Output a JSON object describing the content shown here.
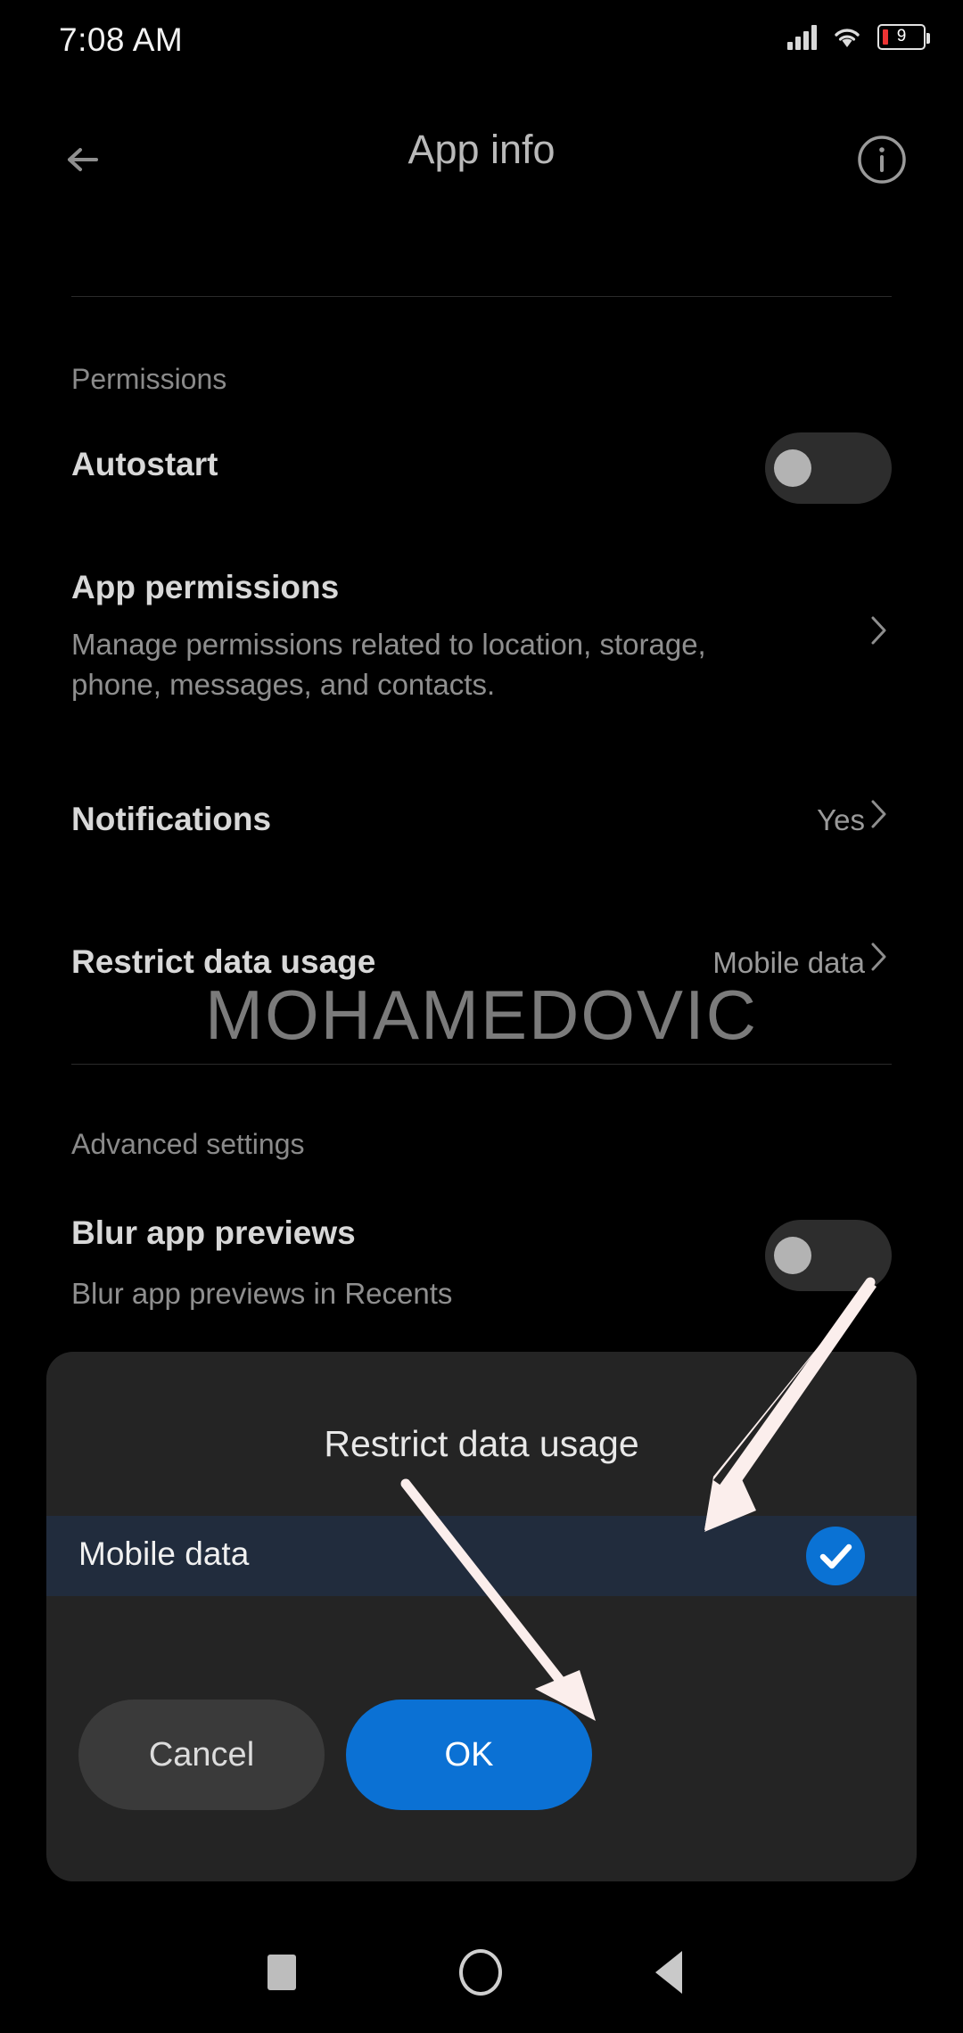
{
  "statusbar": {
    "time": "7:08 AM",
    "battery_level": "9",
    "signal_icon": "signal-bars-icon",
    "wifi_icon": "wifi-icon",
    "battery_icon": "battery-icon"
  },
  "appbar": {
    "title": "App info",
    "back_icon": "back-arrow-icon",
    "info_icon": "info-icon"
  },
  "sections": {
    "permissions_label": "Permissions",
    "advanced_label": "Advanced settings"
  },
  "rows": {
    "autostart": {
      "title": "Autostart",
      "toggle_state": "off"
    },
    "app_permissions": {
      "title": "App permissions",
      "subtitle_line1": "Manage permissions related to location, storage,",
      "subtitle_line2": "phone, messages, and contacts."
    },
    "notifications": {
      "title": "Notifications",
      "value": "Yes"
    },
    "restrict_data_usage": {
      "title": "Restrict data usage",
      "value": "Mobile data"
    },
    "blur_app_previews": {
      "title": "Blur app previews",
      "subtitle": "Blur app previews in Recents",
      "toggle_state": "off"
    }
  },
  "watermark": {
    "text": "MOHAMEDOVIC"
  },
  "dialog": {
    "title": "Restrict data usage",
    "options": [
      {
        "label": "Mobile data",
        "selected": true
      }
    ],
    "cancel_label": "Cancel",
    "ok_label": "OK"
  },
  "navbar": {
    "recents_icon": "square-recents-icon",
    "home_icon": "circle-home-icon",
    "back_icon": "triangle-back-icon"
  },
  "colors": {
    "accent_blue": "#0b71d4",
    "highlight_row": "#212c3d",
    "dialog_bg": "#242424",
    "arrow": "#fbeeec",
    "battery_red": "#e33333"
  }
}
